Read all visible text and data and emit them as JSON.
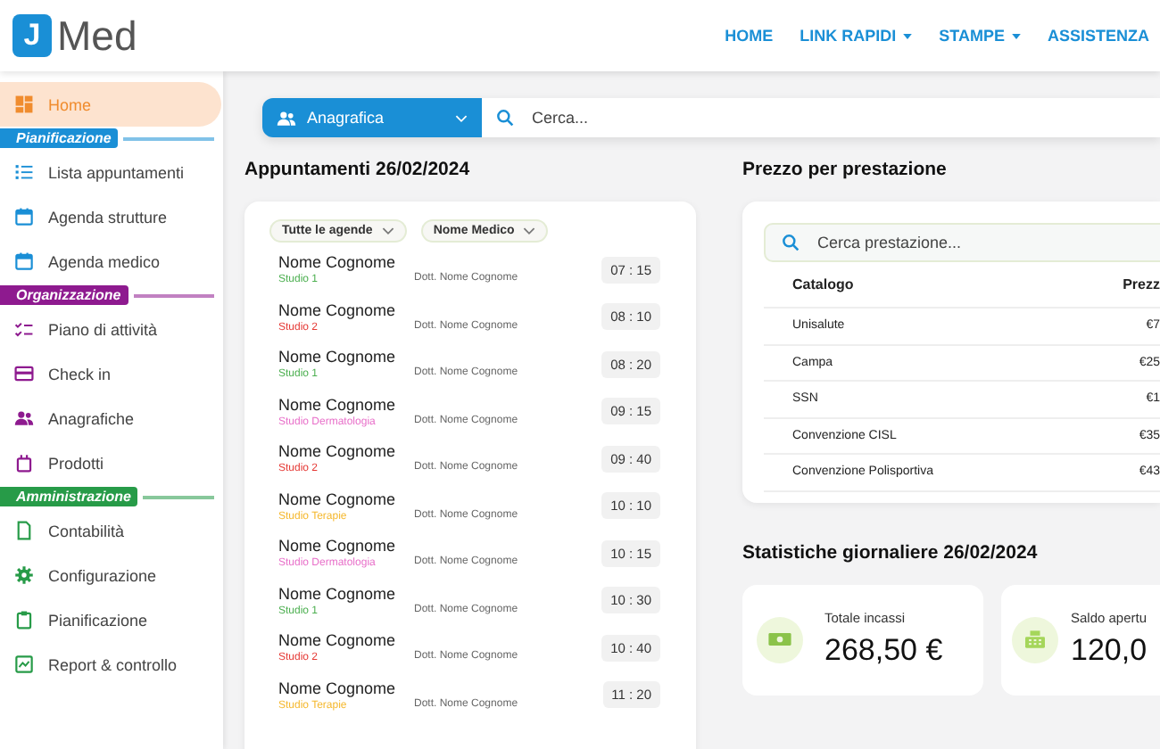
{
  "brand": {
    "logo_letter": "J",
    "name": "Med"
  },
  "nav": [
    {
      "label": "HOME",
      "dropdown": false
    },
    {
      "label": "LINK RAPIDI",
      "dropdown": true
    },
    {
      "label": "STAMPE",
      "dropdown": true
    },
    {
      "label": "ASSISTENZA",
      "dropdown": false
    }
  ],
  "sidebar": {
    "home": {
      "label": "Home",
      "selected": true
    },
    "sections": [
      {
        "title": "Pianificazione",
        "color": "#1a8fd6",
        "items": [
          {
            "label": "Lista appuntamenti",
            "selected": false
          },
          {
            "label": "Agenda strutture",
            "selected": false
          },
          {
            "label": "Agenda medico",
            "selected": false
          }
        ]
      },
      {
        "title": "Organizzazione",
        "color": "#8e1a8f",
        "items": [
          {
            "label": "Piano di attività",
            "selected": false
          },
          {
            "label": "Check in",
            "selected": false
          },
          {
            "label": "Anagrafiche",
            "selected": false
          },
          {
            "label": "Prodotti",
            "selected": false
          }
        ]
      },
      {
        "title": "Amministrazione",
        "color": "#279b48",
        "items": [
          {
            "label": "Contabilità",
            "selected": false
          },
          {
            "label": "Configurazione",
            "selected": false
          },
          {
            "label": "Pianificazione",
            "selected": false
          },
          {
            "label": "Report & controllo",
            "selected": false
          }
        ]
      }
    ]
  },
  "search": {
    "category": "Anagrafica",
    "placeholder": "Cerca..."
  },
  "appointments": {
    "title": "Appuntamenti 26/02/2024",
    "filters": [
      "Tutte le agende",
      "Nome Medico"
    ],
    "rows": [
      {
        "patient": "Nome Cognome",
        "studio": "Studio 1",
        "color": "#4caf50",
        "doctor": "Dott. Nome Cognome",
        "time": "07 : 15"
      },
      {
        "patient": "Nome Cognome",
        "studio": "Studio 2",
        "color": "#e53935",
        "doctor": "Dott. Nome Cognome",
        "time": "08 : 10"
      },
      {
        "patient": "Nome Cognome",
        "studio": "Studio 1",
        "color": "#4caf50",
        "doctor": "Dott. Nome Cognome",
        "time": "08 : 20"
      },
      {
        "patient": "Nome Cognome",
        "studio": "Studio Dermatologia",
        "color": "#e86fc9",
        "doctor": "Dott. Nome Cognome",
        "time": "09 : 15"
      },
      {
        "patient": "Nome Cognome",
        "studio": "Studio 2",
        "color": "#e53935",
        "doctor": "Dott. Nome Cognome",
        "time": "09 : 40"
      },
      {
        "patient": "Nome Cognome",
        "studio": "Studio Terapie",
        "color": "#f5b82e",
        "doctor": "Dott. Nome Cognome",
        "time": "10 : 10"
      },
      {
        "patient": "Nome Cognome",
        "studio": "Studio Dermatologia",
        "color": "#e86fc9",
        "doctor": "Dott. Nome Cognome",
        "time": "10 : 15"
      },
      {
        "patient": "Nome Cognome",
        "studio": "Studio 1",
        "color": "#4caf50",
        "doctor": "Dott. Nome Cognome",
        "time": "10 : 30"
      },
      {
        "patient": "Nome Cognome",
        "studio": "Studio 2",
        "color": "#e53935",
        "doctor": "Dott. Nome Cognome",
        "time": "10 : 40"
      },
      {
        "patient": "Nome Cognome",
        "studio": "Studio Terapie",
        "color": "#f5b82e",
        "doctor": "Dott. Nome Cognome",
        "time": "11 : 20"
      }
    ]
  },
  "prices": {
    "title": "Prezzo per prestazione",
    "placeholder": "Cerca prestazione...",
    "columns": [
      "Catalogo",
      "Prezz"
    ],
    "rows": [
      {
        "catalog": "Unisalute",
        "price": "€7"
      },
      {
        "catalog": "Campa",
        "price": "€25"
      },
      {
        "catalog": "SSN",
        "price": "€1"
      },
      {
        "catalog": "Convenzione CISL",
        "price": "€35"
      },
      {
        "catalog": "Convenzione Polisportiva",
        "price": "€43"
      }
    ]
  },
  "stats": {
    "title": "Statistiche giornaliere 26/02/2024",
    "cards": [
      {
        "label": "Totale incassi",
        "value": "268,50 €"
      },
      {
        "label": "Saldo apertu",
        "value": "120,0"
      }
    ]
  }
}
